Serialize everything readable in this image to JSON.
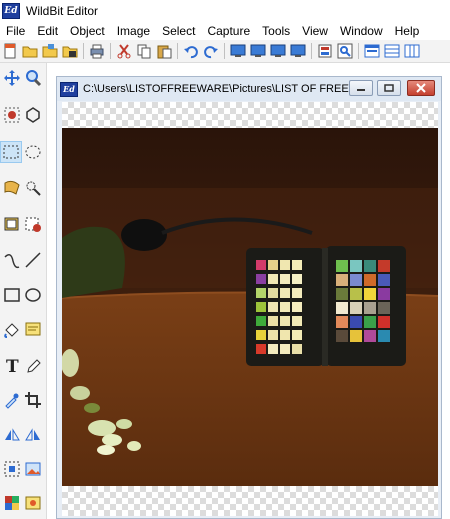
{
  "app": {
    "title": "WildBit Editor",
    "icon_text": "Ed"
  },
  "menu": [
    "File",
    "Edit",
    "Object",
    "Image",
    "Select",
    "Capture",
    "Tools",
    "View",
    "Window",
    "Help"
  ],
  "document": {
    "title": "C:\\Users\\LISTOFFREEWARE\\Pictures\\LIST OF FREEW...",
    "icon_text": "Ed"
  },
  "colors": {
    "accent": "#1f3f9e",
    "selected_tool_bg": "#cce4f7",
    "close_button": "#c4402f"
  },
  "toolbar_icons": [
    "new-icon",
    "open-icon",
    "open-folder-icon",
    "save-icon",
    "print-icon",
    "cut-icon",
    "copy-icon",
    "paste-icon",
    "undo-icon",
    "redo-icon",
    "monitor-icon",
    "monitor-icon",
    "monitor-icon",
    "monitor-icon",
    "image-properties-icon",
    "zoom-fit-icon",
    "tile-icon",
    "layout-horizontal-icon",
    "layout-vertical-icon"
  ],
  "tools": [
    [
      "move-icon",
      "zoom-icon"
    ],
    [
      "lasso-erase-icon",
      "polygon-icon"
    ],
    [
      "rect-select-icon",
      "ellipse-select-icon"
    ],
    [
      "magic-wand-icon",
      "color-select-icon"
    ],
    [
      "crop-box-icon",
      "remove-box-icon"
    ],
    [
      "curve-icon",
      "line-icon"
    ],
    [
      "rectangle-icon",
      "ellipse-icon"
    ],
    [
      "fill-icon",
      "note-icon"
    ],
    [
      "text-icon",
      "pencil-icon"
    ],
    [
      "eyedropper-icon",
      "crop-icon"
    ],
    [
      "flip-icon",
      "mirror-icon"
    ],
    [
      "select-all-icon",
      "image-icon"
    ],
    [
      "palette-icon",
      "effects-icon"
    ]
  ]
}
